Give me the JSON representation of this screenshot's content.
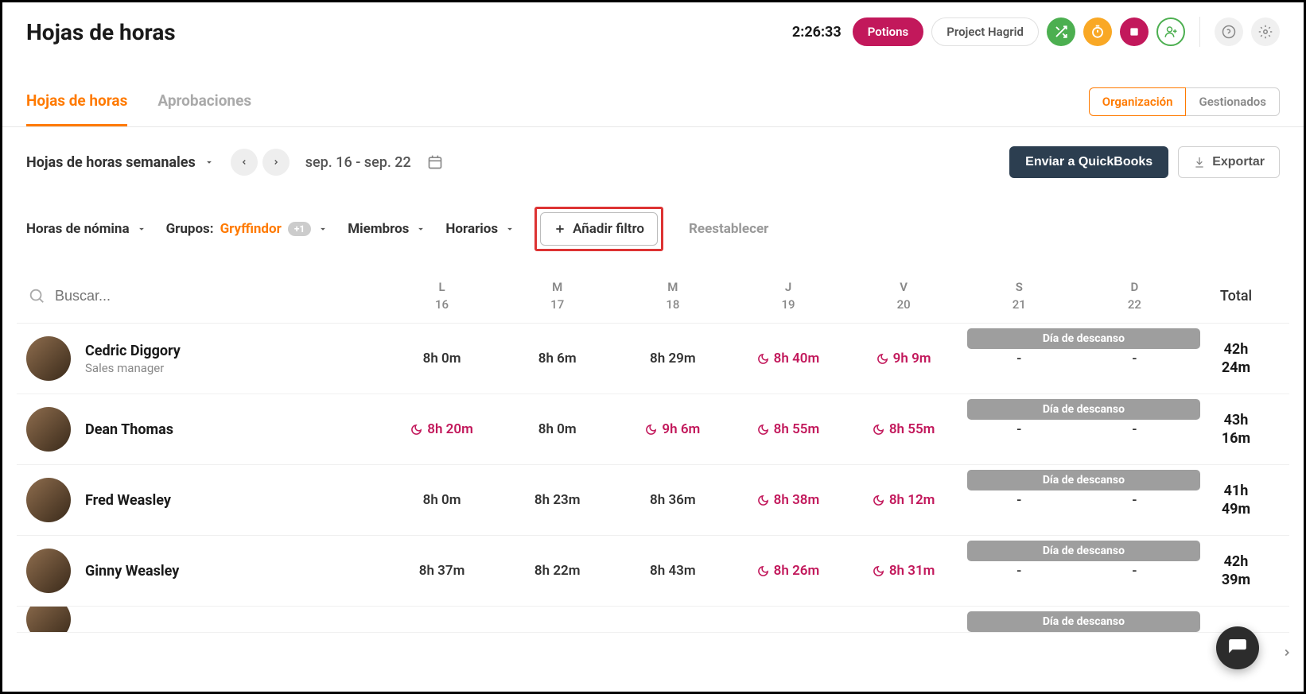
{
  "header": {
    "page_title": "Hojas de horas",
    "timer": "2:26:33",
    "pill_active": "Potions",
    "pill_secondary": "Project Hagrid"
  },
  "tabs": {
    "items": [
      "Hojas de horas",
      "Aprobaciones"
    ],
    "segment_active": "Organización",
    "segment_inactive": "Gestionados"
  },
  "controls": {
    "period_label": "Hojas de horas semanales",
    "date_range": "sep. 16 - sep. 22",
    "quickbooks": "Enviar a QuickBooks",
    "export": "Exportar"
  },
  "filters": {
    "hours": "Horas de nómina",
    "groups_label": "Grupos:",
    "groups_value": "Gryffindor",
    "groups_badge": "+1",
    "members": "Miembros",
    "schedules": "Horarios",
    "add_filter": "Añadir filtro",
    "reset": "Reestablecer"
  },
  "table": {
    "search_placeholder": "Buscar...",
    "days": [
      {
        "dow": "L",
        "num": "16"
      },
      {
        "dow": "M",
        "num": "17"
      },
      {
        "dow": "M",
        "num": "18"
      },
      {
        "dow": "J",
        "num": "19"
      },
      {
        "dow": "V",
        "num": "20"
      },
      {
        "dow": "S",
        "num": "21"
      },
      {
        "dow": "D",
        "num": "22"
      }
    ],
    "total_label": "Total",
    "rest_label": "Día de descanso",
    "rows": [
      {
        "name": "Cedric Diggory",
        "role": "Sales manager",
        "cells": [
          {
            "val": "8h 0m",
            "alert": false
          },
          {
            "val": "8h 6m",
            "alert": false
          },
          {
            "val": "8h 29m",
            "alert": false
          },
          {
            "val": "8h 40m",
            "alert": true
          },
          {
            "val": "9h 9m",
            "alert": true
          },
          {
            "val": "-",
            "alert": false
          },
          {
            "val": "-",
            "alert": false
          }
        ],
        "total": "42h 24m"
      },
      {
        "name": "Dean Thomas",
        "role": "",
        "cells": [
          {
            "val": "8h 20m",
            "alert": true
          },
          {
            "val": "8h 0m",
            "alert": false
          },
          {
            "val": "9h 6m",
            "alert": true
          },
          {
            "val": "8h 55m",
            "alert": true
          },
          {
            "val": "8h 55m",
            "alert": true
          },
          {
            "val": "-",
            "alert": false
          },
          {
            "val": "-",
            "alert": false
          }
        ],
        "total": "43h 16m"
      },
      {
        "name": "Fred Weasley",
        "role": "",
        "cells": [
          {
            "val": "8h 0m",
            "alert": false
          },
          {
            "val": "8h 23m",
            "alert": false
          },
          {
            "val": "8h 36m",
            "alert": false
          },
          {
            "val": "8h 38m",
            "alert": true
          },
          {
            "val": "8h 12m",
            "alert": true
          },
          {
            "val": "-",
            "alert": false
          },
          {
            "val": "-",
            "alert": false
          }
        ],
        "total": "41h 49m"
      },
      {
        "name": "Ginny Weasley",
        "role": "",
        "cells": [
          {
            "val": "8h 37m",
            "alert": false
          },
          {
            "val": "8h 22m",
            "alert": false
          },
          {
            "val": "8h 43m",
            "alert": false
          },
          {
            "val": "8h 26m",
            "alert": true
          },
          {
            "val": "8h 31m",
            "alert": true
          },
          {
            "val": "-",
            "alert": false
          },
          {
            "val": "-",
            "alert": false
          }
        ],
        "total": "42h 39m"
      }
    ]
  }
}
